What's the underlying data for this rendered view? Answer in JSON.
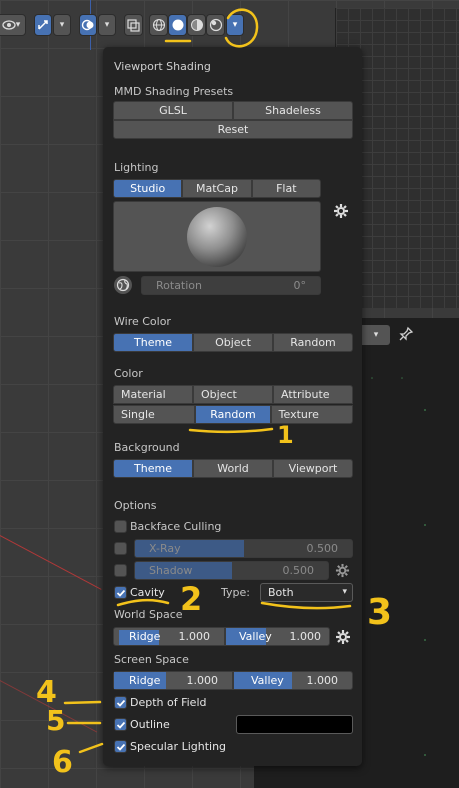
{
  "header": {
    "chevron": "▾"
  },
  "popover": {
    "title": "Viewport Shading",
    "mmd": {
      "section": "MMD Shading Presets",
      "glsl": "GLSL",
      "shadeless": "Shadeless",
      "reset": "Reset"
    },
    "lighting": {
      "section": "Lighting",
      "options": [
        "Studio",
        "MatCap",
        "Flat"
      ],
      "selected": "Studio",
      "rotation_label": "Rotation",
      "rotation_value": "0°"
    },
    "wire_color": {
      "section": "Wire Color",
      "options": [
        "Theme",
        "Object",
        "Random"
      ],
      "selected": "Theme"
    },
    "color": {
      "section": "Color",
      "options": [
        "Material",
        "Object",
        "Attribute",
        "Single",
        "Random",
        "Texture"
      ],
      "selected": "Random"
    },
    "background": {
      "section": "Background",
      "options": [
        "Theme",
        "World",
        "Viewport"
      ],
      "selected": "Theme"
    },
    "options": {
      "section": "Options",
      "backface_culling": "Backface Culling",
      "xray_label": "X-Ray",
      "xray_value": "0.500",
      "xray_fraction": 0.5,
      "shadow_label": "Shadow",
      "shadow_value": "0.500",
      "shadow_fraction": 0.5,
      "cavity": "Cavity",
      "type_label": "Type:",
      "type_value": "Both",
      "world_space": "World Space",
      "ws_ridge_label": "Ridge",
      "ws_ridge_value": "1.000",
      "ws_valley_label": "Valley",
      "ws_valley_value": "1.000",
      "screen_space": "Screen Space",
      "ss_ridge_label": "Ridge",
      "ss_ridge_value": "1.000",
      "ss_valley_label": "Valley",
      "ss_valley_value": "1.000",
      "depth_of_field": "Depth of Field",
      "outline": "Outline",
      "outline_color": "#000000",
      "specular_lighting": "Specular Lighting"
    }
  },
  "annotations": [
    "1",
    "2",
    "3",
    "4",
    "5",
    "6"
  ],
  "colors": {
    "accent": "#4772b3",
    "annotation": "#f2c21b",
    "panel": "#232323"
  }
}
